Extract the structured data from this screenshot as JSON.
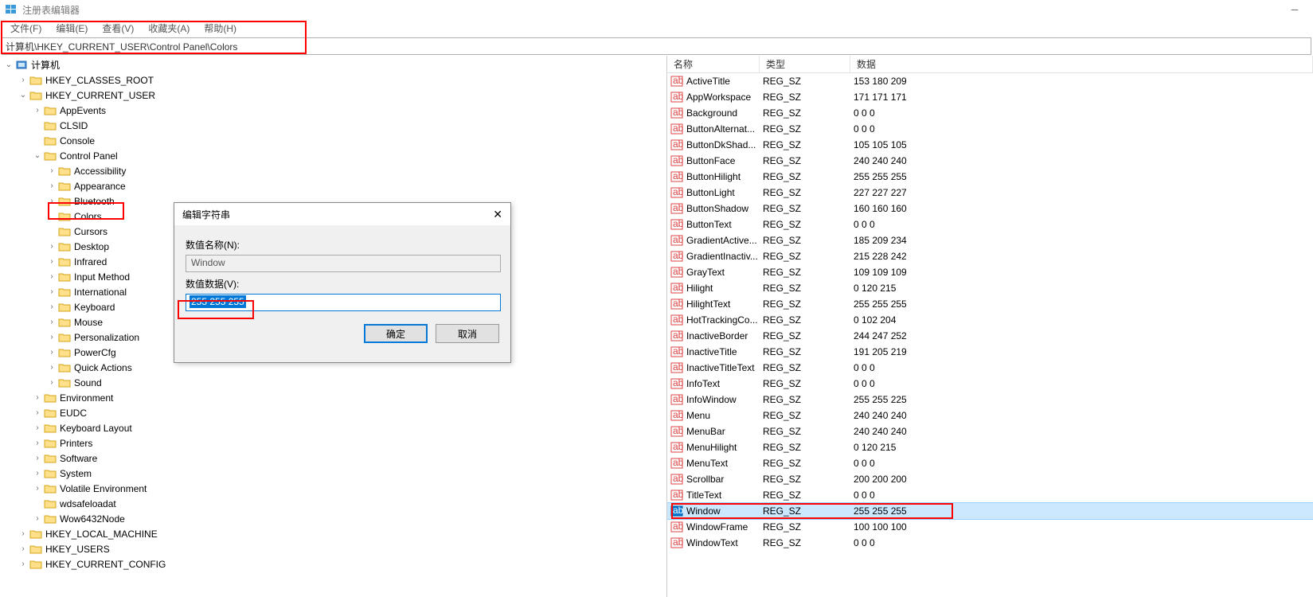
{
  "window": {
    "title": "注册表编辑器"
  },
  "menu": {
    "file": "文件(F)",
    "edit": "编辑(E)",
    "view": "查看(V)",
    "favorites": "收藏夹(A)",
    "help": "帮助(H)"
  },
  "address": "计算机\\HKEY_CURRENT_USER\\Control Panel\\Colors",
  "tree": {
    "computer": "计算机",
    "hives": {
      "hkcr": "HKEY_CLASSES_ROOT",
      "hkcu": "HKEY_CURRENT_USER",
      "hklm": "HKEY_LOCAL_MACHINE",
      "hku": "HKEY_USERS",
      "hkcc": "HKEY_CURRENT_CONFIG"
    },
    "hkcu_children": [
      "AppEvents",
      "CLSID",
      "Console",
      "Control Panel",
      "Environment",
      "EUDC",
      "Keyboard Layout",
      "Printers",
      "Software",
      "System",
      "Volatile Environment",
      "wdsafeloadat",
      "Wow6432Node"
    ],
    "control_panel_children": [
      "Accessibility",
      "Appearance",
      "Bluetooth",
      "Colors",
      "Cursors",
      "Desktop",
      "Infrared",
      "Input Method",
      "International",
      "Keyboard",
      "Mouse",
      "Personalization",
      "PowerCfg",
      "Quick Actions",
      "Sound"
    ]
  },
  "columns": {
    "name": "名称",
    "type": "类型",
    "data": "数据"
  },
  "values": [
    {
      "name": "ActiveTitle",
      "type": "REG_SZ",
      "data": "153 180 209"
    },
    {
      "name": "AppWorkspace",
      "type": "REG_SZ",
      "data": "171 171 171"
    },
    {
      "name": "Background",
      "type": "REG_SZ",
      "data": "0 0 0"
    },
    {
      "name": "ButtonAlternat...",
      "type": "REG_SZ",
      "data": "0 0 0"
    },
    {
      "name": "ButtonDkShad...",
      "type": "REG_SZ",
      "data": "105 105 105"
    },
    {
      "name": "ButtonFace",
      "type": "REG_SZ",
      "data": "240 240 240"
    },
    {
      "name": "ButtonHilight",
      "type": "REG_SZ",
      "data": "255 255 255"
    },
    {
      "name": "ButtonLight",
      "type": "REG_SZ",
      "data": "227 227 227"
    },
    {
      "name": "ButtonShadow",
      "type": "REG_SZ",
      "data": "160 160 160"
    },
    {
      "name": "ButtonText",
      "type": "REG_SZ",
      "data": "0 0 0"
    },
    {
      "name": "GradientActive...",
      "type": "REG_SZ",
      "data": "185 209 234"
    },
    {
      "name": "GradientInactiv...",
      "type": "REG_SZ",
      "data": "215 228 242"
    },
    {
      "name": "GrayText",
      "type": "REG_SZ",
      "data": "109 109 109"
    },
    {
      "name": "Hilight",
      "type": "REG_SZ",
      "data": "0 120 215"
    },
    {
      "name": "HilightText",
      "type": "REG_SZ",
      "data": "255 255 255"
    },
    {
      "name": "HotTrackingCo...",
      "type": "REG_SZ",
      "data": "0 102 204"
    },
    {
      "name": "InactiveBorder",
      "type": "REG_SZ",
      "data": "244 247 252"
    },
    {
      "name": "InactiveTitle",
      "type": "REG_SZ",
      "data": "191 205 219"
    },
    {
      "name": "InactiveTitleText",
      "type": "REG_SZ",
      "data": "0 0 0"
    },
    {
      "name": "InfoText",
      "type": "REG_SZ",
      "data": "0 0 0"
    },
    {
      "name": "InfoWindow",
      "type": "REG_SZ",
      "data": "255 255 225"
    },
    {
      "name": "Menu",
      "type": "REG_SZ",
      "data": "240 240 240"
    },
    {
      "name": "MenuBar",
      "type": "REG_SZ",
      "data": "240 240 240"
    },
    {
      "name": "MenuHilight",
      "type": "REG_SZ",
      "data": "0 120 215"
    },
    {
      "name": "MenuText",
      "type": "REG_SZ",
      "data": "0 0 0"
    },
    {
      "name": "Scrollbar",
      "type": "REG_SZ",
      "data": "200 200 200"
    },
    {
      "name": "TitleText",
      "type": "REG_SZ",
      "data": "0 0 0"
    },
    {
      "name": "Window",
      "type": "REG_SZ",
      "data": "255 255 255",
      "selected": true
    },
    {
      "name": "WindowFrame",
      "type": "REG_SZ",
      "data": "100 100 100"
    },
    {
      "name": "WindowText",
      "type": "REG_SZ",
      "data": "0 0 0"
    }
  ],
  "dialog": {
    "title": "编辑字符串",
    "name_label": "数值名称(N):",
    "name_value": "Window",
    "data_label": "数值数据(V):",
    "data_value": "255 255 255",
    "ok": "确定",
    "cancel": "取消"
  }
}
